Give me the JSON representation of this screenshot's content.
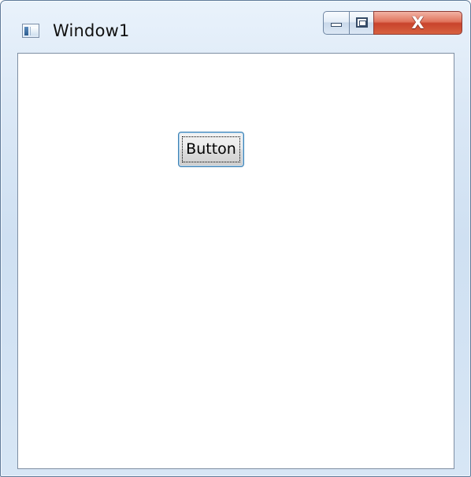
{
  "window": {
    "title": "Window1",
    "caption_buttons": {
      "minimize_icon": "minimize-icon",
      "maximize_icon": "maximize-icon",
      "close_symbol": "X"
    }
  },
  "content": {
    "button_label": "Button"
  },
  "colors": {
    "frame": "#d7e6f5",
    "client_background": "#ffffff",
    "close_button": "#c9432c",
    "focus_border": "#3c7fb1"
  }
}
